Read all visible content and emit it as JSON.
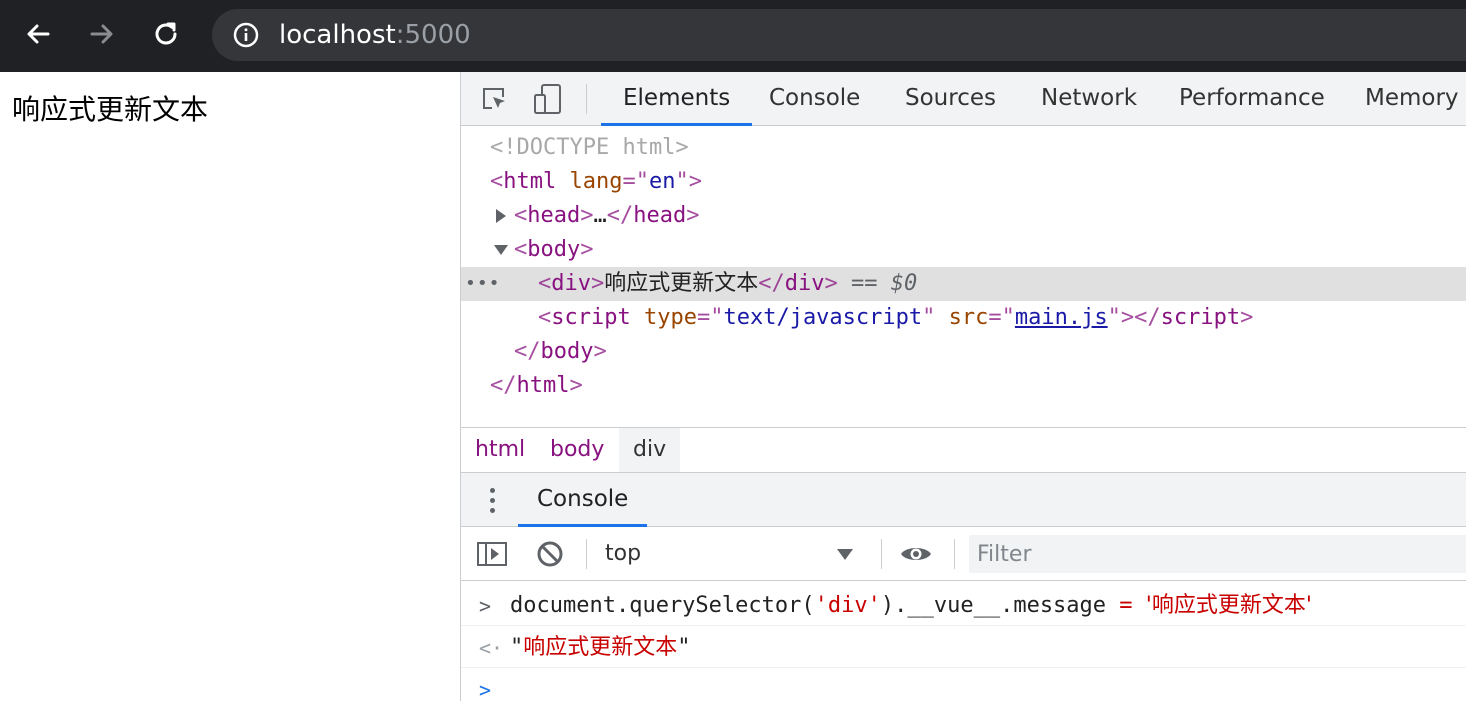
{
  "browser": {
    "url_host": "localhost",
    "url_port": ":5000",
    "icons": {
      "back": "arrow-left-icon",
      "forward": "arrow-right-icon",
      "reload": "reload-icon",
      "info": "info-circle-icon"
    }
  },
  "page": {
    "div_text": "响应式更新文本"
  },
  "devtools": {
    "tabs": [
      "Elements",
      "Console",
      "Sources",
      "Network",
      "Performance",
      "Memory"
    ],
    "active_tab": "Elements",
    "tree": {
      "doctype": "<!DOCTYPE html>",
      "html_tag": "html",
      "lang_attr": "lang",
      "lang_val": "en",
      "head_tag": "head",
      "ellipsis": "…",
      "body_tag": "body",
      "div_tag": "div",
      "div_text": "响应式更新文本",
      "eq": "==",
      "ref": "$0",
      "script_tag": "script",
      "type_attr": "type",
      "type_val": "text/javascript",
      "src_attr": "src",
      "src_val": "main.js"
    },
    "breadcrumbs": [
      "html",
      "body",
      "div"
    ],
    "drawer_tab": "Console",
    "console": {
      "context": "top",
      "filter_placeholder": "Filter",
      "input_code_prefix": "document.querySelector(",
      "input_code_arg": "'div'",
      "input_code_mid": ").__vue__.message",
      "input_code_eq": " = ",
      "input_code_val": "'响应式更新文本'",
      "result_value": "响应式更新文本",
      "quote": "\""
    }
  },
  "colors": {
    "accent": "#1a73e8",
    "tag": "#881280",
    "attr": "#994500",
    "value": "#1a1aa6",
    "string": "#c80000"
  }
}
